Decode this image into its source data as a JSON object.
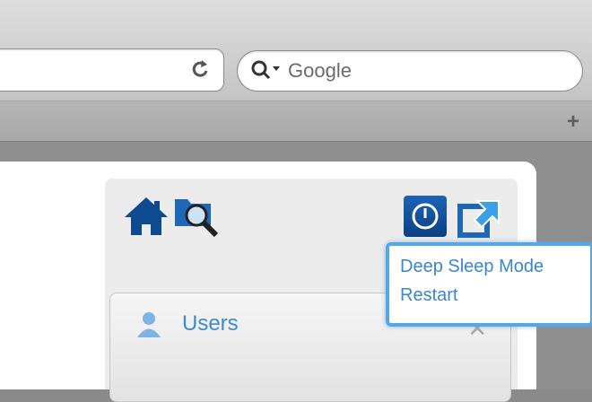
{
  "browser": {
    "search_placeholder": "Google",
    "new_tab_symbol": "+"
  },
  "icons": {
    "reload": "reload-icon",
    "search": "search-icon",
    "home": "home-icon",
    "browse": "folder-search-icon",
    "power": "power-icon",
    "external": "external-link-icon",
    "user": "user-icon",
    "close": "close-icon"
  },
  "power_menu": {
    "items": [
      {
        "label": "Deep Sleep Mode"
      },
      {
        "label": "Restart"
      }
    ]
  },
  "users_panel": {
    "title": "Users",
    "close_symbol": "✕"
  },
  "colors": {
    "accent": "#3b86ce",
    "menu_border": "#58a7e3",
    "power_button": "#1d64b5"
  }
}
